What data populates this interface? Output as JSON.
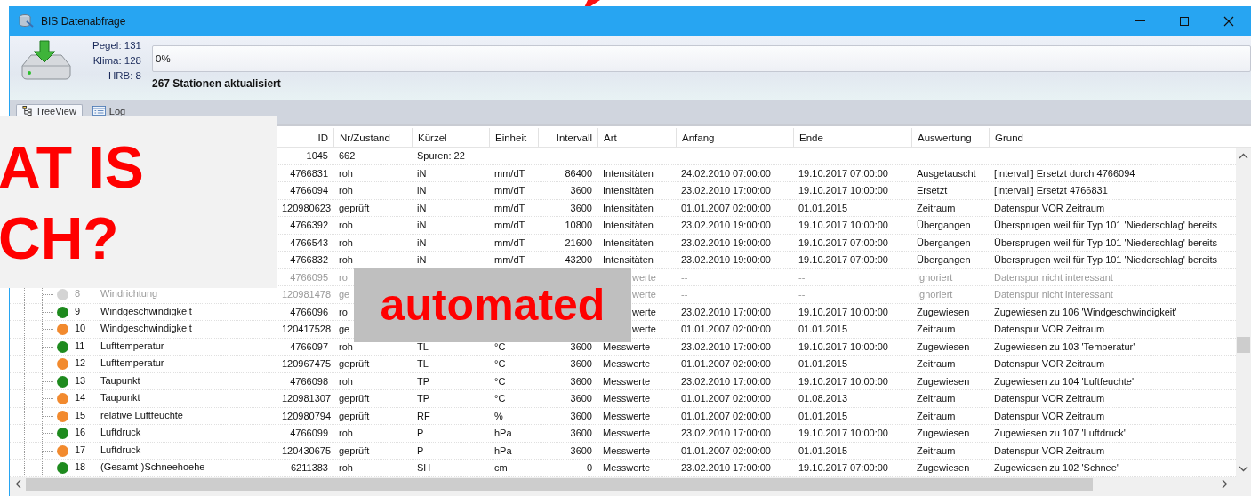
{
  "window": {
    "title": "BIS Datenabfrage"
  },
  "summary": {
    "counts": [
      "Pegel: 131",
      "Klima: 128",
      "HRB: 8"
    ],
    "progress": {
      "level": 0,
      "reading": "0%"
    },
    "status": "267 Stationen aktualisiert"
  },
  "tabs": [
    {
      "label": "TreeView",
      "selected": true
    },
    {
      "label": "Log",
      "selected": false
    }
  ],
  "table": {
    "columns": [
      "ID",
      "Nr/Zustand",
      "Kürzel",
      "Einheit",
      "Intervall",
      "Art",
      "Anfang",
      "Ende",
      "Auswertung",
      "Grund"
    ],
    "rows": [
      {
        "kind": "station",
        "disabled": false,
        "id": "1045",
        "zustand": "662",
        "spuren": "Spuren: 22"
      },
      {
        "kind": "track",
        "disabled": false,
        "id": "4766831",
        "zustand": "roh",
        "kuerzel": "iN",
        "einheit": "mm/dT",
        "intervall": "86400",
        "art": "Intensitäten",
        "anfang": "24.02.2010 07:00:00",
        "ende": "19.10.2017 07:00:00",
        "auswertung": "Ausgetauscht",
        "grund": "[Intervall] Ersetzt durch 4766094"
      },
      {
        "kind": "track",
        "disabled": false,
        "id": "4766094",
        "zustand": "roh",
        "kuerzel": "iN",
        "einheit": "mm/dT",
        "intervall": "3600",
        "art": "Intensitäten",
        "anfang": "23.02.2010 17:00:00",
        "ende": "19.10.2017 10:00:00",
        "auswertung": "Ersetzt",
        "grund": "[Intervall] Ersetzt 4766831"
      },
      {
        "kind": "track",
        "disabled": false,
        "id": "120980623",
        "zustand": "geprüft",
        "kuerzel": "iN",
        "einheit": "mm/dT",
        "intervall": "3600",
        "art": "Intensitäten",
        "anfang": "01.01.2007 02:00:00",
        "ende": "01.01.2015",
        "auswertung": "Zeitraum",
        "grund": "Datenspur VOR Zeitraum"
      },
      {
        "kind": "track",
        "disabled": false,
        "id": "4766392",
        "zustand": "roh",
        "kuerzel": "iN",
        "einheit": "mm/dT",
        "intervall": "10800",
        "art": "Intensitäten",
        "anfang": "23.02.2010 19:00:00",
        "ende": "19.10.2017 10:00:00",
        "auswertung": "Übergangen",
        "grund": "Übersprugen weil für Typ 101 'Niederschlag' bereits"
      },
      {
        "kind": "track",
        "disabled": false,
        "id": "4766543",
        "zustand": "roh",
        "kuerzel": "iN",
        "einheit": "mm/dT",
        "intervall": "21600",
        "art": "Intensitäten",
        "anfang": "23.02.2010 19:00:00",
        "ende": "19.10.2017 07:00:00",
        "auswertung": "Übergangen",
        "grund": "Übersprugen weil für Typ 101 'Niederschlag' bereits"
      },
      {
        "kind": "track",
        "disabled": false,
        "id": "4766832",
        "zustand": "roh",
        "kuerzel": "iN",
        "einheit": "mm/dT",
        "intervall": "43200",
        "art": "Intensitäten",
        "anfang": "23.02.2010 19:00:00",
        "ende": "19.10.2017 07:00:00",
        "auswertung": "Übergangen",
        "grund": "Übersprugen weil für Typ 101 'Niederschlag' bereits"
      },
      {
        "kind": "track",
        "disabled": true,
        "id": "4766095",
        "zustand": "ro",
        "art_tail": "werte",
        "anfang": "--",
        "ende": "--",
        "auswertung": "Ignoriert",
        "grund": "Datenspur nicht interessant"
      },
      {
        "kind": "track",
        "disabled": true,
        "color": "#d4d4d4",
        "nr": "8",
        "name": "Windrichtung",
        "id": "120981478",
        "zustand": "ge",
        "art_tail": "werte",
        "anfang": "--",
        "ende": "--",
        "auswertung": "Ignoriert",
        "grund": "Datenspur nicht interessant"
      },
      {
        "kind": "track",
        "disabled": false,
        "color": "#1e8a1e",
        "nr": "9",
        "name": "Windgeschwindigkeit",
        "id": "4766096",
        "zustand": "ro",
        "art_tail": "werte",
        "anfang": "23.02.2010 17:00:00",
        "ende": "19.10.2017 10:00:00",
        "auswertung": "Zugewiesen",
        "grund": "Zugewiesen zu 106 'Windgeschwindigkeit'"
      },
      {
        "kind": "track",
        "disabled": false,
        "color": "#f28a2e",
        "nr": "10",
        "name": "Windgeschwindigkeit",
        "id": "120417528",
        "zustand": "ge",
        "art_tail": "werte",
        "anfang": "01.01.2007 02:00:00",
        "ende": "01.01.2015",
        "auswertung": "Zeitraum",
        "grund": "Datenspur VOR Zeitraum"
      },
      {
        "kind": "track",
        "disabled": false,
        "color": "#1e8a1e",
        "nr": "11",
        "name": "Lufttemperatur",
        "id": "4766097",
        "zustand": "roh",
        "kuerzel": "TL",
        "einheit": "°C",
        "intervall": "3600",
        "art": "Messwerte",
        "anfang": "23.02.2010 17:00:00",
        "ende": "19.10.2017 10:00:00",
        "auswertung": "Zugewiesen",
        "grund": "Zugewiesen zu 103 'Temperatur'"
      },
      {
        "kind": "track",
        "disabled": false,
        "color": "#f28a2e",
        "nr": "12",
        "name": "Lufttemperatur",
        "id": "120967475",
        "zustand": "geprüft",
        "kuerzel": "TL",
        "einheit": "°C",
        "intervall": "3600",
        "art": "Messwerte",
        "anfang": "01.01.2007 02:00:00",
        "ende": "01.01.2015",
        "auswertung": "Zeitraum",
        "grund": "Datenspur VOR Zeitraum"
      },
      {
        "kind": "track",
        "disabled": false,
        "color": "#1e8a1e",
        "nr": "13",
        "name": "Taupunkt",
        "id": "4766098",
        "zustand": "roh",
        "kuerzel": "TP",
        "einheit": "°C",
        "intervall": "3600",
        "art": "Messwerte",
        "anfang": "23.02.2010 17:00:00",
        "ende": "19.10.2017 10:00:00",
        "auswertung": "Zugewiesen",
        "grund": "Zugewiesen zu 104 'Luftfeuchte'"
      },
      {
        "kind": "track",
        "disabled": false,
        "color": "#f28a2e",
        "nr": "14",
        "name": "Taupunkt",
        "id": "120981307",
        "zustand": "geprüft",
        "kuerzel": "TP",
        "einheit": "°C",
        "intervall": "3600",
        "art": "Messwerte",
        "anfang": "01.01.2007 02:00:00",
        "ende": "01.08.2013",
        "auswertung": "Zeitraum",
        "grund": "Datenspur VOR Zeitraum"
      },
      {
        "kind": "track",
        "disabled": false,
        "color": "#f28a2e",
        "nr": "15",
        "name": "relative Luftfeuchte",
        "id": "120980794",
        "zustand": "geprüft",
        "kuerzel": "RF",
        "einheit": "%",
        "intervall": "3600",
        "art": "Messwerte",
        "anfang": "01.01.2007 02:00:00",
        "ende": "01.01.2015",
        "auswertung": "Zeitraum",
        "grund": "Datenspur VOR Zeitraum"
      },
      {
        "kind": "track",
        "disabled": false,
        "color": "#1e8a1e",
        "nr": "16",
        "name": "Luftdruck",
        "id": "4766099",
        "zustand": "roh",
        "kuerzel": "P",
        "einheit": "hPa",
        "intervall": "3600",
        "art": "Messwerte",
        "anfang": "23.02.2010 17:00:00",
        "ende": "19.10.2017 10:00:00",
        "auswertung": "Zugewiesen",
        "grund": "Zugewiesen zu 107 'Luftdruck'"
      },
      {
        "kind": "track",
        "disabled": false,
        "color": "#f28a2e",
        "nr": "17",
        "name": "Luftdruck",
        "id": "120430675",
        "zustand": "geprüft",
        "kuerzel": "P",
        "einheit": "hPa",
        "intervall": "3600",
        "art": "Messwerte",
        "anfang": "01.01.2007 02:00:00",
        "ende": "01.01.2015",
        "auswertung": "Zeitraum",
        "grund": "Datenspur VOR Zeitraum"
      },
      {
        "kind": "track",
        "disabled": false,
        "color": "#1e8a1e",
        "nr": "18",
        "name": "(Gesamt-)Schneehoehe",
        "id": "6211383",
        "zustand": "roh",
        "kuerzel": "SH",
        "einheit": "cm",
        "intervall": "0",
        "art": "Messwerte",
        "anfang": "23.02.2010 17:00:00",
        "ende": "19.10.2017 07:00:00",
        "auswertung": "Zugewiesen",
        "grund": "Zugewiesen zu 102 'Schnee'"
      }
    ]
  },
  "overlays": [
    {
      "kind": "question",
      "lines": [
        "AT IS",
        "CH?"
      ]
    },
    {
      "kind": "tag",
      "lines": [
        "automated"
      ]
    }
  ]
}
